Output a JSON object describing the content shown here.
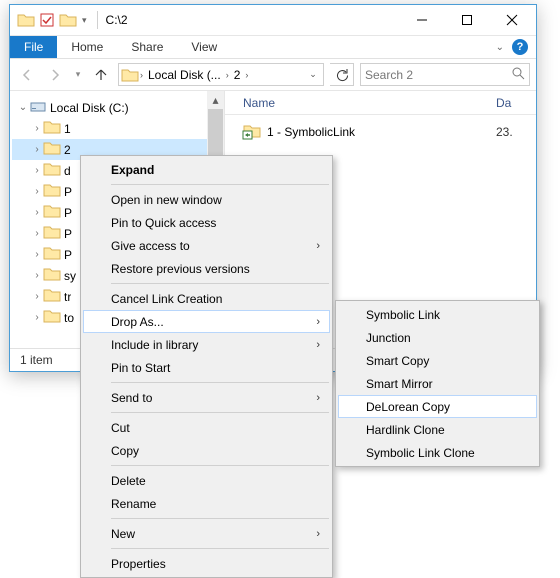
{
  "titlebar": {
    "title": "C:\\2"
  },
  "ribbon": {
    "file": "File",
    "tabs": [
      "Home",
      "Share",
      "View"
    ]
  },
  "address": {
    "crumbs": [
      "Local Disk (...",
      "2"
    ],
    "search_placeholder": "Search 2"
  },
  "tree": {
    "root": "Local Disk (C:)",
    "items": [
      "1",
      "2",
      "d",
      "P",
      "P",
      "P",
      "P",
      "sy",
      "tr",
      "to"
    ],
    "selected_index": 1
  },
  "columns": {
    "name": "Name",
    "date": "Da"
  },
  "files": [
    {
      "name": "1 - SymbolicLink",
      "date": "23."
    }
  ],
  "status": "1 item",
  "context_menu": {
    "items": [
      {
        "label": "Expand",
        "bold": true
      },
      {
        "sep": true
      },
      {
        "label": "Open in new window"
      },
      {
        "label": "Pin to Quick access"
      },
      {
        "label": "Give access to",
        "submenu": true
      },
      {
        "label": "Restore previous versions"
      },
      {
        "sep": true
      },
      {
        "label": "Cancel Link Creation"
      },
      {
        "label": "Drop As...",
        "submenu": true,
        "hover": true
      },
      {
        "label": "Include in library",
        "submenu": true
      },
      {
        "label": "Pin to Start"
      },
      {
        "sep": true
      },
      {
        "label": "Send to",
        "submenu": true
      },
      {
        "sep": true
      },
      {
        "label": "Cut"
      },
      {
        "label": "Copy"
      },
      {
        "sep": true
      },
      {
        "label": "Delete"
      },
      {
        "label": "Rename"
      },
      {
        "sep": true
      },
      {
        "label": "New",
        "submenu": true
      },
      {
        "sep": true
      },
      {
        "label": "Properties"
      }
    ]
  },
  "submenu": {
    "items": [
      {
        "label": "Symbolic Link"
      },
      {
        "label": "Junction"
      },
      {
        "label": "Smart Copy"
      },
      {
        "label": "Smart Mirror"
      },
      {
        "label": "DeLorean Copy",
        "hover": true
      },
      {
        "label": "Hardlink Clone"
      },
      {
        "label": "Symbolic Link Clone"
      }
    ]
  }
}
